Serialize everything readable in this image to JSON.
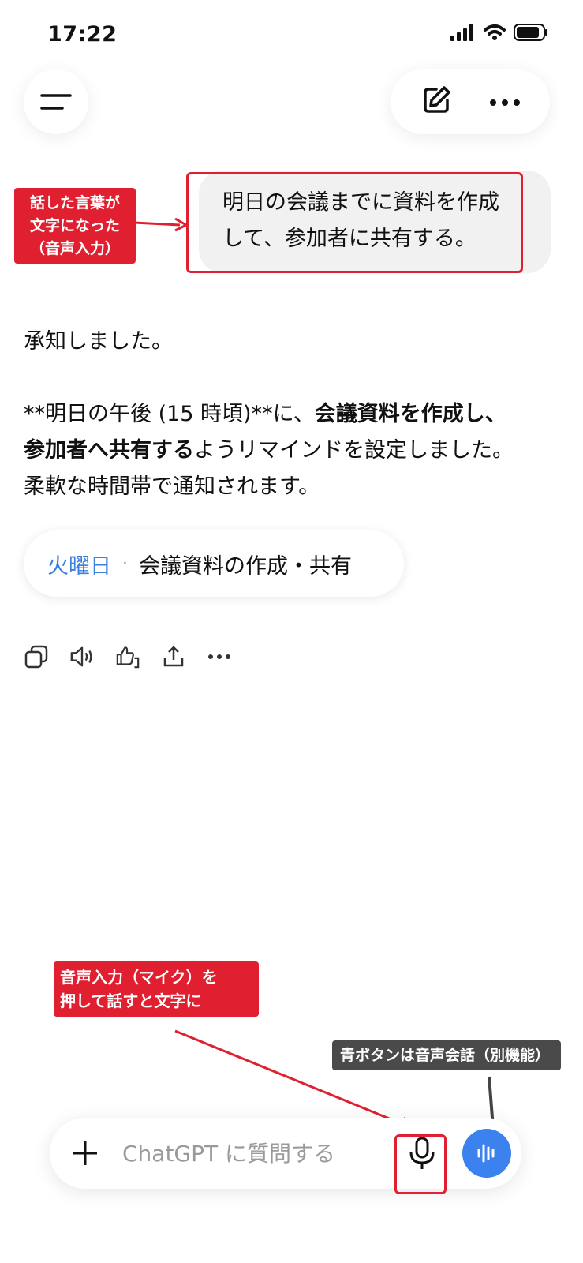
{
  "status_bar": {
    "time": "17:22"
  },
  "user_message": {
    "line1": "明日の会議までに資料を作成",
    "line2": "して、参加者に共有する。"
  },
  "annotations": {
    "speech_label": {
      "line1": "話した言葉が",
      "line2": "文字になった",
      "line3": "（音声入力）"
    },
    "mic_label": {
      "line1": "音声入力（マイク）を",
      "line2": "押して話すと文字に"
    },
    "voice_label": "青ボタンは音声会話（別機能）"
  },
  "assistant": {
    "ack": "承知しました。",
    "p2_prefix": "**明日の午後 (15 時頃)**に、",
    "p2_bold1": "会議資料を作成し、",
    "p2_bold2": "参加者へ共有する",
    "p2_rest": "ようリマインドを設定しました。",
    "p2_line3": "柔軟な時間帯で通知されます。"
  },
  "reminder_chip": {
    "day": "火曜日",
    "separator": "·",
    "title": "会議資料の作成・共有"
  },
  "composer": {
    "placeholder": "ChatGPT に質問する"
  },
  "colors": {
    "accent_blue": "#3b82ee",
    "annotation_red": "#e02030",
    "chip_day": "#3b7fe0"
  },
  "icons": [
    "menu-icon",
    "new-chat-icon",
    "more-icon",
    "copy-icon",
    "speaker-icon",
    "thumbs-icon",
    "share-icon",
    "plus-icon",
    "mic-icon",
    "voice-wave-icon"
  ]
}
